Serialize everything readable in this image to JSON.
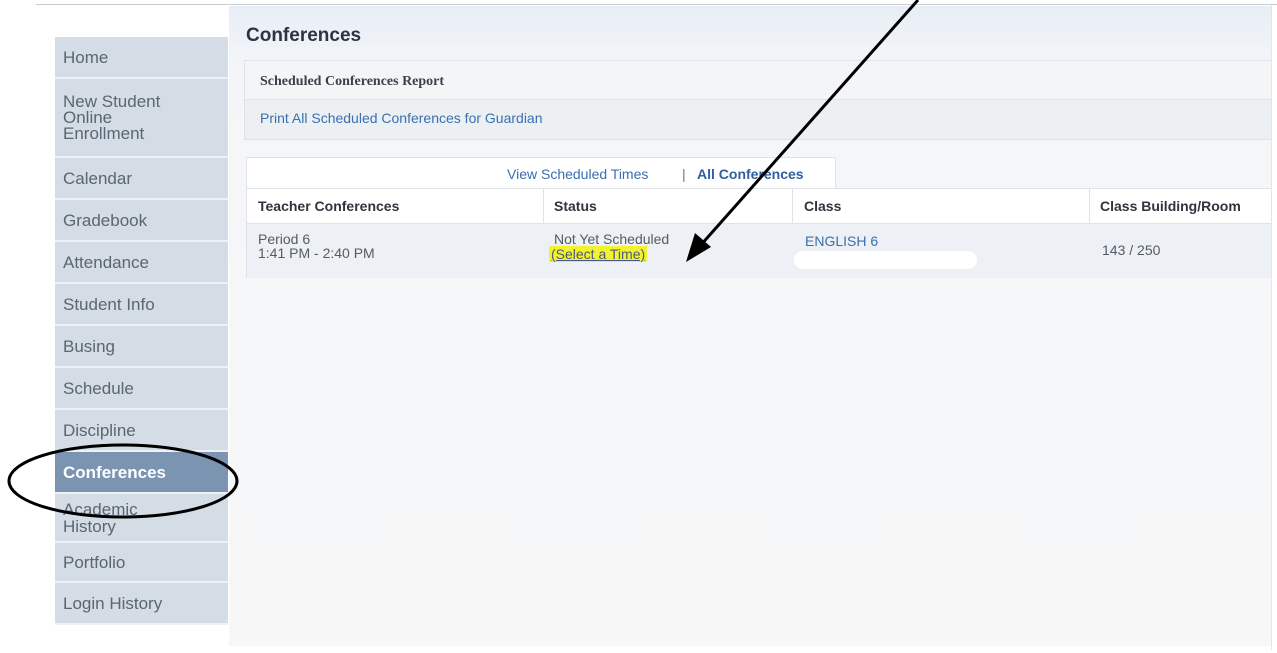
{
  "sidebar": {
    "items": [
      {
        "label": "Home"
      },
      {
        "label": "New Student\nOnline\nEnrollment"
      },
      {
        "label": "Calendar"
      },
      {
        "label": "Gradebook"
      },
      {
        "label": "Attendance"
      },
      {
        "label": "Student Info"
      },
      {
        "label": "Busing"
      },
      {
        "label": "Schedule"
      },
      {
        "label": "Discipline"
      },
      {
        "label": "Conferences",
        "active": true
      },
      {
        "label": "Academic\nHistory"
      },
      {
        "label": "Portfolio"
      },
      {
        "label": "Login History"
      }
    ]
  },
  "page": {
    "title": "Conferences"
  },
  "report": {
    "title": "Scheduled Conferences Report",
    "print_link": "Print All Scheduled Conferences for Guardian"
  },
  "tabs": {
    "view_scheduled": "View Scheduled Times",
    "separator": "|",
    "all_conferences": "All Conferences"
  },
  "table": {
    "headers": [
      "Teacher Conferences",
      "Status",
      "Class",
      "Class Building/Room"
    ],
    "rows": [
      {
        "period": "Period 6",
        "time": "1:41 PM - 2:40 PM",
        "status": "Not Yet Scheduled",
        "action": "(Select a Time)",
        "class": "ENGLISH 6",
        "room": "143 / 250"
      }
    ]
  },
  "colors": {
    "sidebar_bg": "#d4dce5",
    "sidebar_active_bg": "#7b94b2",
    "link": "#3a6fb0",
    "highlight": "#f2f230"
  }
}
